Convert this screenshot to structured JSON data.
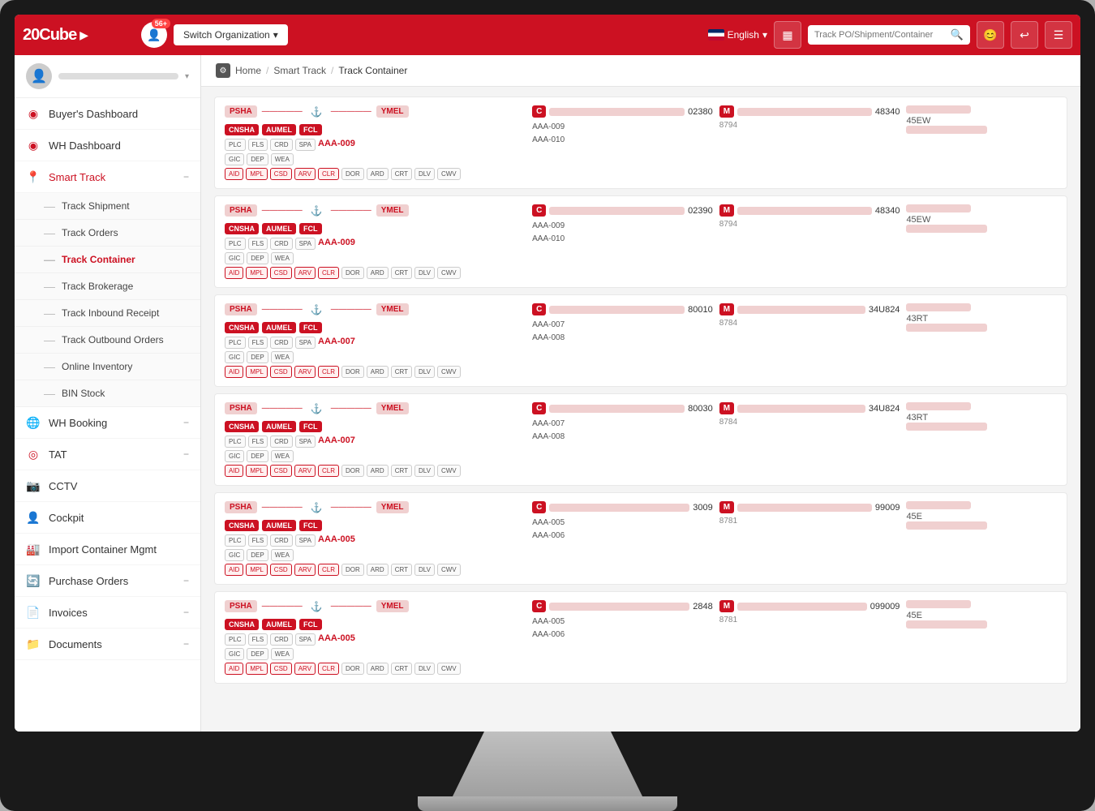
{
  "app": {
    "title": "20Cube"
  },
  "topnav": {
    "logo": "20Cube",
    "notif_count": "56+",
    "switch_org": "Switch Organization",
    "lang": "English",
    "search_placeholder": "Track PO/Shipment/Container"
  },
  "breadcrumb": {
    "home": "Home",
    "section": "Smart Track",
    "current": "Track Container"
  },
  "sidebar": {
    "user_name": "",
    "items": [
      {
        "id": "buyers-dashboard",
        "label": "Buyer's Dashboard",
        "icon": "◉",
        "expandable": false
      },
      {
        "id": "wh-dashboard",
        "label": "WH Dashboard",
        "icon": "◉",
        "expandable": false
      },
      {
        "id": "smart-track",
        "label": "Smart Track",
        "icon": "📍",
        "expandable": true,
        "active": true
      },
      {
        "id": "wh-booking",
        "label": "WH Booking",
        "icon": "🌐",
        "expandable": true
      },
      {
        "id": "tat",
        "label": "TAT",
        "icon": "◎",
        "expandable": true
      },
      {
        "id": "cctv",
        "label": "CCTV",
        "icon": "📷",
        "expandable": false
      },
      {
        "id": "cockpit",
        "label": "Cockpit",
        "icon": "👤",
        "expandable": false
      },
      {
        "id": "import-container",
        "label": "Import Container Mgmt",
        "icon": "🏭",
        "expandable": false
      },
      {
        "id": "purchase-orders",
        "label": "Purchase Orders",
        "icon": "🔄",
        "expandable": true
      },
      {
        "id": "invoices",
        "label": "Invoices",
        "icon": "📄",
        "expandable": true
      },
      {
        "id": "documents",
        "label": "Documents",
        "icon": "📁",
        "expandable": true
      }
    ],
    "smart_track_subitems": [
      {
        "id": "track-shipment",
        "label": "Track Shipment"
      },
      {
        "id": "track-orders",
        "label": "Track Orders"
      },
      {
        "id": "track-container",
        "label": "Track Container",
        "active": true
      },
      {
        "id": "track-brokerage",
        "label": "Track Brokerage"
      },
      {
        "id": "track-inbound",
        "label": "Track Inbound Receipt"
      },
      {
        "id": "track-outbound",
        "label": "Track Outbound Orders"
      },
      {
        "id": "online-inventory",
        "label": "Online Inventory"
      },
      {
        "id": "bin-stock",
        "label": "BIN Stock"
      }
    ]
  },
  "cards": [
    {
      "id": "card1",
      "origin": "PSHA",
      "dest": "YMEL",
      "badges": [
        "CNSHA",
        "AUMEL",
        "FCL"
      ],
      "pills_row1": [
        "PLC",
        "FLS",
        "CRD",
        "SPA"
      ],
      "pills_row2": [
        "GIC",
        "DEP",
        "WEA"
      ],
      "pills_row3": [
        "AID",
        "MPL",
        "CSD",
        "ARV",
        "CLR",
        "DOR",
        "ARD",
        "CRT",
        "DLV",
        "CWV"
      ],
      "po_link": "AAA-009",
      "container_id": "02380",
      "po_list": [
        "AAA-009",
        "AAA-010"
      ],
      "mbl_id": "48340",
      "hbl": "8794",
      "type": "45EW"
    },
    {
      "id": "card2",
      "origin": "PSHA",
      "dest": "YMEL",
      "badges": [
        "CNSHA",
        "AUMEL",
        "FCL"
      ],
      "pills_row1": [
        "PLC",
        "FLS",
        "CRD",
        "SPA"
      ],
      "pills_row2": [
        "GIC",
        "DEP",
        "WEA"
      ],
      "pills_row3": [
        "AID",
        "MPL",
        "CSD",
        "ARV",
        "CLR",
        "DOR",
        "ARD",
        "CRT",
        "DLV",
        "CWV"
      ],
      "po_link": "AAA-009",
      "container_id": "02390",
      "po_list": [
        "AAA-009",
        "AAA-010"
      ],
      "mbl_id": "48340",
      "hbl": "8794",
      "type": "45EW"
    },
    {
      "id": "card3",
      "origin": "PSHA",
      "dest": "YMEL",
      "badges": [
        "CNSHA",
        "AUMEL",
        "FCL"
      ],
      "pills_row1": [
        "PLC",
        "FLS",
        "CRD",
        "SPA"
      ],
      "pills_row2": [
        "GIC",
        "DEP",
        "WEA"
      ],
      "pills_row3": [
        "AID",
        "MPL",
        "CSD",
        "ARV",
        "CLR",
        "DOR",
        "ARD",
        "CRT",
        "DLV",
        "CWV"
      ],
      "po_link": "AAA-007",
      "container_id": "80010",
      "po_list": [
        "AAA-007",
        "AAA-008"
      ],
      "mbl_id": "34U824",
      "hbl": "8784",
      "type": "43RT"
    },
    {
      "id": "card4",
      "origin": "PSHA",
      "dest": "YMEL",
      "badges": [
        "CNSHA",
        "AUMEL",
        "FCL"
      ],
      "pills_row1": [
        "PLC",
        "FLS",
        "CRD",
        "SPA"
      ],
      "pills_row2": [
        "GIC",
        "DEP",
        "WEA"
      ],
      "pills_row3": [
        "AID",
        "MPL",
        "CSD",
        "ARV",
        "CLR",
        "DOR",
        "ARD",
        "CRT",
        "DLV",
        "CWV"
      ],
      "po_link": "AAA-007",
      "container_id": "80030",
      "po_list": [
        "AAA-007",
        "AAA-008"
      ],
      "mbl_id": "34U824",
      "hbl": "8784",
      "type": "43RT"
    },
    {
      "id": "card5",
      "origin": "PSHA",
      "dest": "YMEL",
      "badges": [
        "CNSHA",
        "AUMEL",
        "FCL"
      ],
      "pills_row1": [
        "PLC",
        "FLS",
        "CRD",
        "SPA"
      ],
      "pills_row2": [
        "GIC",
        "DEP",
        "WEA"
      ],
      "pills_row3": [
        "AID",
        "MPL",
        "CSD",
        "ARV",
        "CLR",
        "DOR",
        "ARD",
        "CRT",
        "DLV",
        "CWV"
      ],
      "po_link": "AAA-005",
      "container_id": "3009",
      "po_list": [
        "AAA-005",
        "AAA-006"
      ],
      "mbl_id": "99009",
      "hbl": "8781",
      "type": "45E"
    },
    {
      "id": "card6",
      "origin": "PSHA",
      "dest": "YMEL",
      "badges": [
        "CNSHA",
        "AUMEL",
        "FCL"
      ],
      "pills_row1": [
        "PLC",
        "FLS",
        "CRD",
        "SPA"
      ],
      "pills_row2": [
        "GIC",
        "DEP",
        "WEA"
      ],
      "pills_row3": [
        "AID",
        "MPL",
        "CSD",
        "ARV",
        "CLR",
        "DOR",
        "ARD",
        "CRT",
        "DLV",
        "CWV"
      ],
      "po_link": "AAA-005",
      "container_id": "2848",
      "po_list": [
        "AAA-005",
        "AAA-006"
      ],
      "mbl_id": "099009",
      "hbl": "8781",
      "type": "45E"
    }
  ]
}
